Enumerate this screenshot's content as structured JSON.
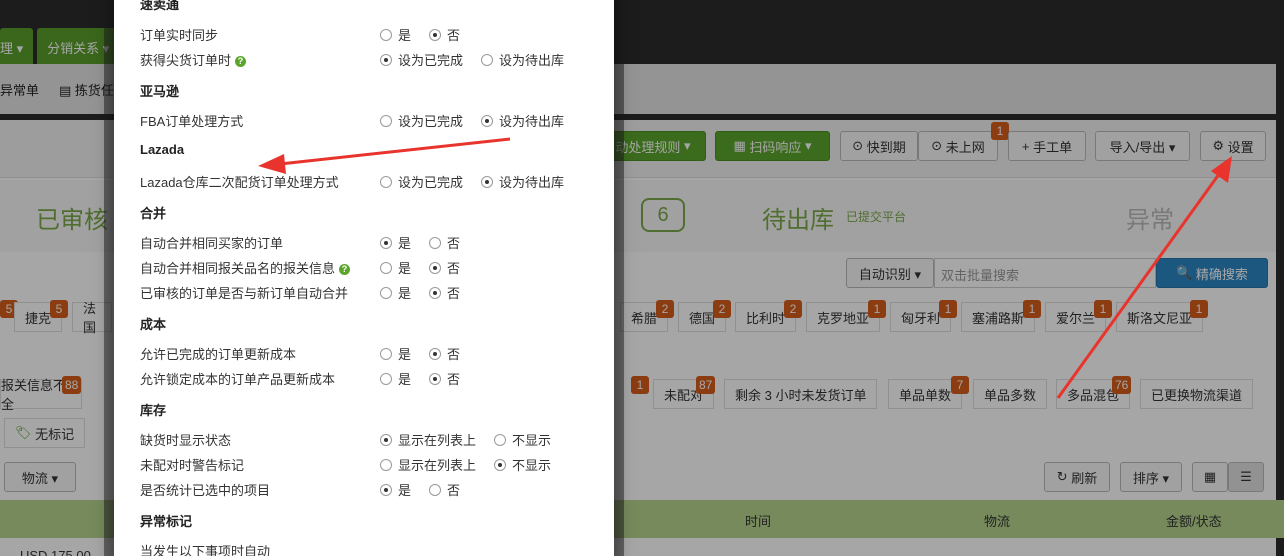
{
  "background": {
    "nav_tabs": [
      "理 ▾",
      "分销关系 ▾"
    ],
    "subbar": [
      "异常单",
      "拣货任务"
    ],
    "toolbar": {
      "rule": "动处理规则",
      "scan": "扫码响应",
      "expiring": "快到期",
      "not_online": "未上网",
      "manual": "手工单",
      "manual_badge": "1",
      "import_export": "导入/导出 ▾",
      "settings": "设置"
    },
    "stages": {
      "reviewed": "已审核",
      "count": "6",
      "pending_out": "待出库",
      "pending_sub": "已提交平台",
      "abnormal": "异常"
    },
    "search": {
      "auto_id": "自动识别 ▾",
      "placeholder": "双击批量搜索",
      "exact": "精确搜索"
    },
    "countries": [
      {
        "name": "捷克",
        "count": "5"
      },
      {
        "name": "法国",
        "count": ""
      },
      {
        "name": "希腊",
        "count": "2"
      },
      {
        "name": "德国",
        "count": "2"
      },
      {
        "name": "比利时",
        "count": "2"
      },
      {
        "name": "克罗地亚",
        "count": "1"
      },
      {
        "name": "匈牙利",
        "count": "1"
      },
      {
        "name": "塞浦路斯",
        "count": "1"
      },
      {
        "name": "爱尔兰",
        "count": "1"
      },
      {
        "name": "斯洛文尼亚",
        "count": "1"
      }
    ],
    "left_badge": "5",
    "filters": [
      {
        "name": "报关信息不全",
        "count": "88"
      },
      {
        "name": "未配对",
        "count": "87"
      },
      {
        "name": "剩余 3 小时未发货订单",
        "count": ""
      },
      {
        "name": "单品单数",
        "count": "7"
      },
      {
        "name": "单品多数",
        "count": ""
      },
      {
        "name": "多品混包",
        "count": "76"
      },
      {
        "name": "已更换物流渠道",
        "count": ""
      }
    ],
    "filter_badge_1": "1",
    "tag": "无标记",
    "actions": {
      "logistics": "物流 ▾",
      "refresh": "刷新",
      "sort": "排序 ▾"
    },
    "table_cols": [
      "时间",
      "物流",
      "金额/状态"
    ],
    "partial_amount": "USD 175.00"
  },
  "modal": {
    "top_section": "速卖通",
    "sections": [
      {
        "title": "",
        "rows": [
          {
            "label": "订单实时同步",
            "opts": [
              "是",
              "否"
            ],
            "sel": 1
          },
          {
            "label": "获得尖货订单时",
            "help": true,
            "opts": [
              "设为已完成",
              "设为待出库"
            ],
            "sel": 0
          }
        ]
      },
      {
        "title": "亚马逊",
        "rows": [
          {
            "label": "FBA订单处理方式",
            "opts": [
              "设为已完成",
              "设为待出库"
            ],
            "sel": 1
          }
        ]
      },
      {
        "title": "Lazada",
        "rows": [
          {
            "label": "Lazada仓库二次配货订单处理方式",
            "opts": [
              "设为已完成",
              "设为待出库"
            ],
            "sel": 1
          }
        ]
      },
      {
        "title": "合并",
        "rows": [
          {
            "label": "自动合并相同买家的订单",
            "opts": [
              "是",
              "否"
            ],
            "sel": 0
          },
          {
            "label": "自动合并相同报关品名的报关信息",
            "help": true,
            "opts": [
              "是",
              "否"
            ],
            "sel": 1
          },
          {
            "label": "已审核的订单是否与新订单自动合并",
            "opts": [
              "是",
              "否"
            ],
            "sel": 1
          }
        ]
      },
      {
        "title": "成本",
        "rows": [
          {
            "label": "允许已完成的订单更新成本",
            "opts": [
              "是",
              "否"
            ],
            "sel": 1
          },
          {
            "label": "允许锁定成本的订单产品更新成本",
            "opts": [
              "是",
              "否"
            ],
            "sel": 1
          }
        ]
      },
      {
        "title": "库存",
        "rows": [
          {
            "label": "缺货时显示状态",
            "opts": [
              "显示在列表上",
              "不显示"
            ],
            "sel": 0
          },
          {
            "label": "未配对时警告标记",
            "opts": [
              "显示在列表上",
              "不显示"
            ],
            "sel": 1
          },
          {
            "label": "是否统计已选中的项目",
            "opts": [
              "是",
              "否"
            ],
            "sel": 0
          }
        ]
      },
      {
        "title": "异常标记",
        "rows": [
          {
            "label": "当发生以下事项时自动",
            "opts": [],
            "sel": -1
          }
        ]
      }
    ]
  },
  "colors": {
    "accent_green": "#5ba52c",
    "badge_orange": "#d65c1a",
    "arrow_red": "#e8342c",
    "header_green": "#b5d58e"
  }
}
